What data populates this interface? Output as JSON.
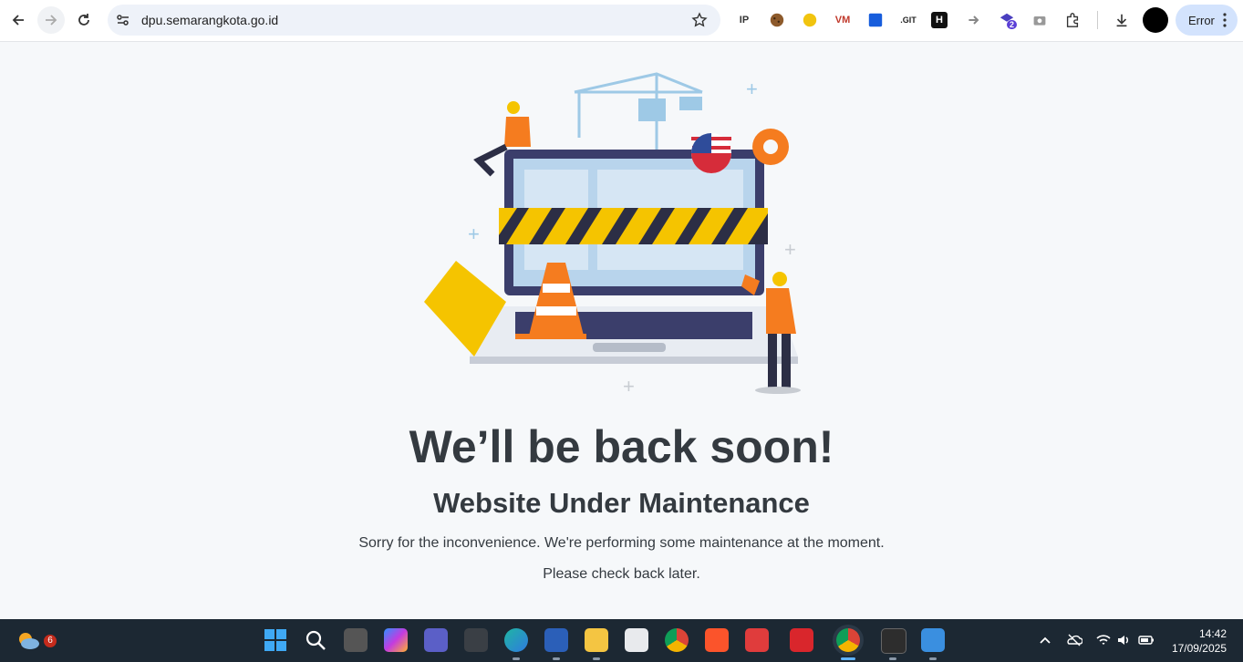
{
  "browser": {
    "url": "dpu.semarangkota.go.id",
    "error_chip_label": "Error",
    "extensions": [
      {
        "name": "ip-extension",
        "label": "IP"
      },
      {
        "name": "cookie-extension",
        "label": ""
      },
      {
        "name": "emoji-extension",
        "label": ""
      },
      {
        "name": "vm-extension",
        "label": "VM"
      },
      {
        "name": "bitwarden-extension",
        "label": ""
      },
      {
        "name": "git-extension",
        "label": ".GIT"
      },
      {
        "name": "h-extension",
        "label": "H"
      },
      {
        "name": "arrow-extension",
        "label": ""
      },
      {
        "name": "layers-extension",
        "label": "2"
      },
      {
        "name": "camera-extension",
        "label": ""
      }
    ]
  },
  "page": {
    "headline": "We’ll be back soon!",
    "subheadline": "Website Under Maintenance",
    "message_line1": "Sorry for the inconvenience. We're performing some maintenance at the moment.",
    "message_line2": "Please check back later."
  },
  "taskbar": {
    "weather_badge": "6",
    "time": "14:42",
    "date": "17/09/2025"
  },
  "colors": {
    "accent_orange": "#f57c1f",
    "hazard_yellow": "#f5c400",
    "text_dark": "#343a40",
    "chip_blue": "#d3e3fd"
  }
}
